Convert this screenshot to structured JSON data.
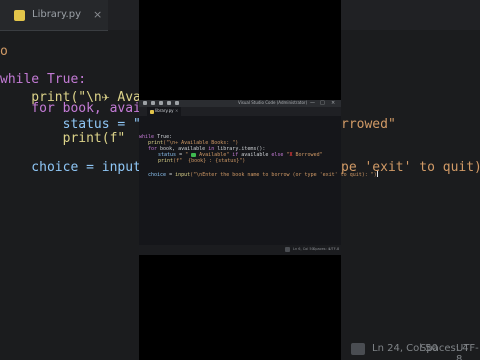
{
  "background_editor": {
    "tab_label": "Library.py",
    "close_glyph": "×",
    "lines": [
      {
        "text": "o"
      },
      {
        "text": "while True:"
      },
      {
        "text": "    print(\"\\n✈ Availab"
      },
      {
        "text": "    for book, available"
      },
      {
        "text": "        status = \""
      },
      {
        "text": "        print(f\"  {book"
      },
      {
        "text": "    choice = input(\"\\nEn"
      }
    ],
    "right_fragments": {
      "borrowed": "rrowed\"",
      "quit": "pe 'exit' to quit): \")"
    },
    "status_bar": {
      "cursor_pos": "Ln 24, Col 50",
      "spaces": "Spaces: 4",
      "encoding": "UTF-8"
    }
  },
  "window": {
    "title": "Visual Studio Code (Administrator)",
    "controls": {
      "minimize": "—",
      "maximize": "□",
      "close": "×"
    },
    "tab_label": "library.py",
    "tab_close": "×",
    "code": {
      "l1_kw": "while",
      "l1_rest": " True:",
      "l2_fn": "print",
      "l2_str": "(\"\\n✈ Available Books: \")",
      "l3_kw": "for",
      "l3_rest": " book, available ",
      "l3_in": "in",
      "l3_obj": " library.items():",
      "l4_var": "status",
      "l4_eq": " = ",
      "l4_str1": "\" ",
      "l4_s2": " Available\" ",
      "l4_if": "if",
      "l4_av": " available ",
      "l4_else": "else",
      "l4_str3": " \"",
      "l4_x": "X",
      "l4_str4": " Borrowed\"",
      "l5_fn": "print",
      "l5_str": "(f\"  {book} : {status}\")",
      "l6_var": "choice",
      "l6_eq": " = ",
      "l6_fn": "input",
      "l6_str": "(\"\\nEnter the book name to borrow (or type 'exit' to quit): \")"
    },
    "status_bar": {
      "cursor_pos": "Ln 6, Col 50",
      "spaces": "Spaces: 4",
      "encoding": "UTF-8"
    }
  }
}
